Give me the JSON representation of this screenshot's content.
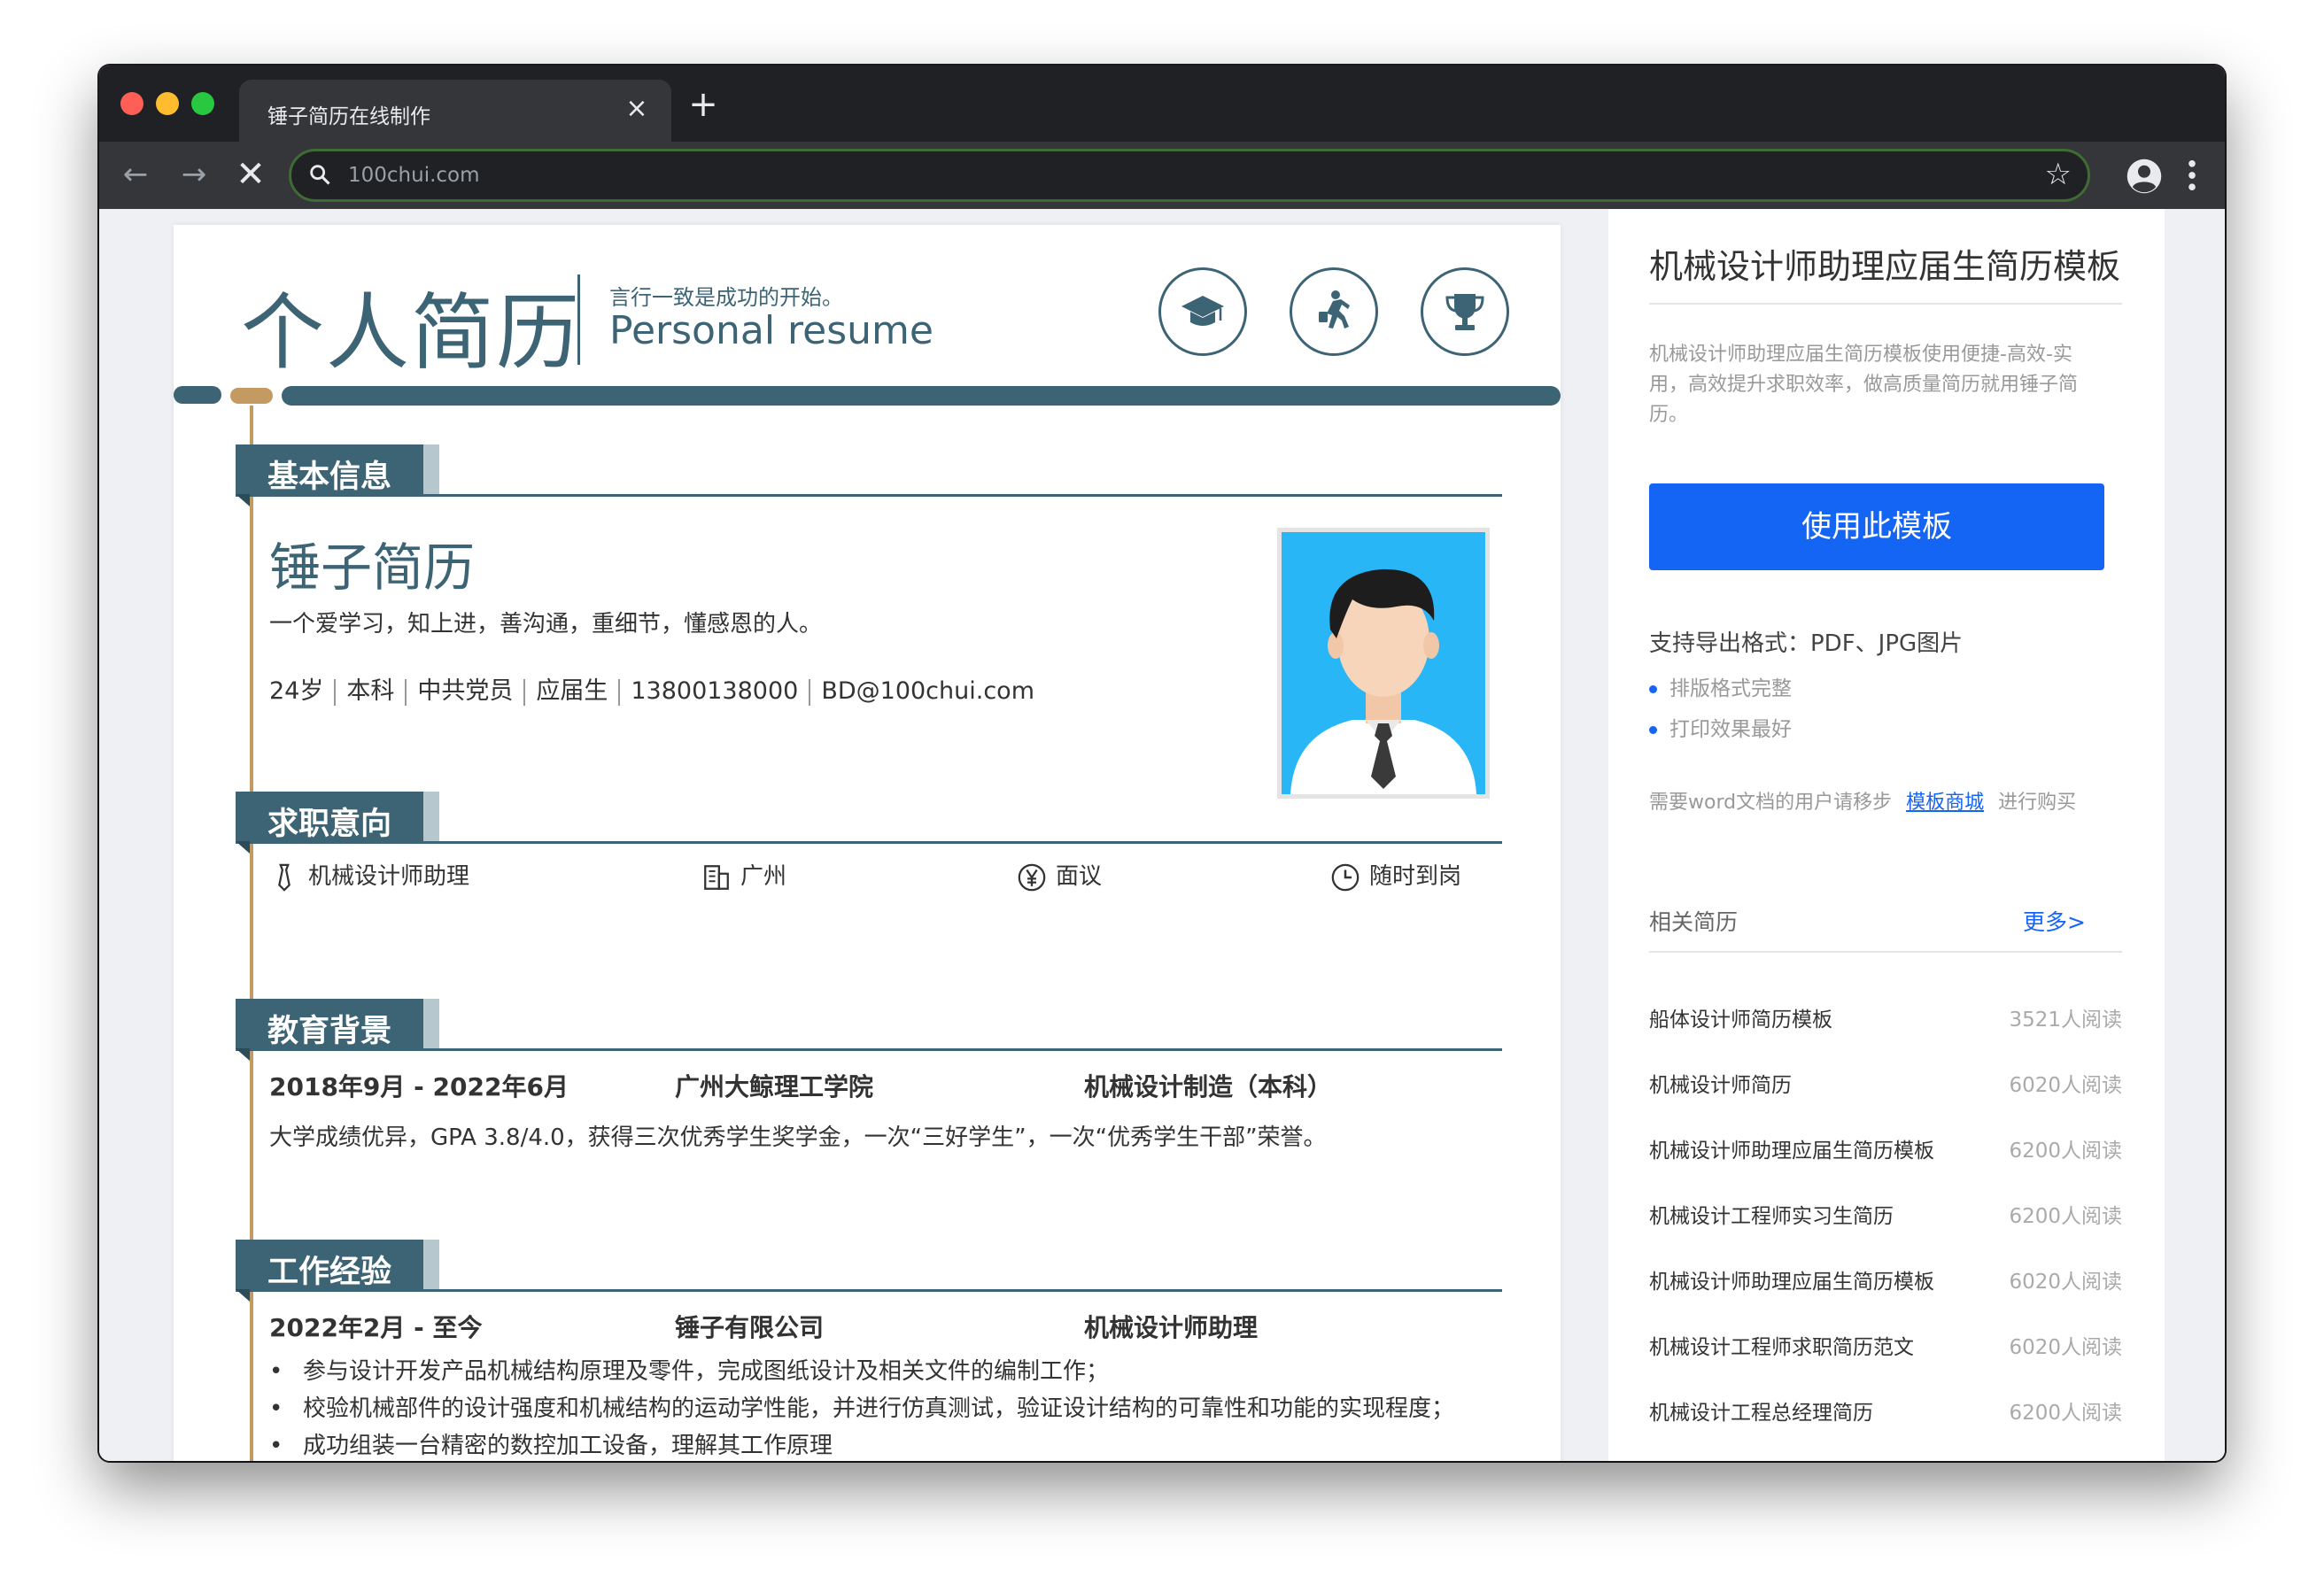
{
  "browser": {
    "tab_title": "锤子简历在线制作",
    "tab_close": "×",
    "new_tab": "+",
    "url": "100chui.com"
  },
  "resume": {
    "title": "个人简历",
    "subtitle_cn": "言行一致是成功的开始。",
    "subtitle_en": "Personal resume",
    "basic": {
      "heading": "基本信息",
      "name": "锤子简历",
      "motto": "一个爱学习，知上进，善沟通，重细节，懂感恩的人。",
      "details": [
        "24岁",
        "本科",
        "中共党员",
        "应届生",
        "13800138000",
        "BD@100chui.com"
      ]
    },
    "intention": {
      "heading": "求职意向",
      "position": "机械设计师助理",
      "city": "广州",
      "salary": "面议",
      "availability": "随时到岗"
    },
    "education": {
      "heading": "教育背景",
      "period": "2018年9月 - 2022年6月",
      "school": "广州大鲸理工学院",
      "major": "机械设计制造（本科）",
      "description": "大学成绩优异，GPA 3.8/4.0，获得三次优秀学生奖学金，一次“三好学生”，一次“优秀学生干部”荣誉。"
    },
    "work": {
      "heading": "工作经验",
      "period": "2022年2月 - 至今",
      "company": "锤子有限公司",
      "role": "机械设计师助理",
      "bullets": [
        "参与设计开发产品机械结构原理及零件，完成图纸设计及相关文件的编制工作；",
        "校验机械部件的设计强度和机械结构的运动学性能，并进行仿真测试，验证设计结构的可靠性和功能的实现程度；",
        "成功组装一台精密的数控加工设备，理解其工作原理"
      ]
    }
  },
  "sidebar": {
    "title": "机械设计师助理应届生简历模板",
    "description": "机械设计师助理应届生简历模板使用便捷-高效-实用，高效提升求职效率，做高质量简历就用锤子简历。",
    "use_button": "使用此模板",
    "formats": "支持导出格式：PDF、JPG图片",
    "features": [
      "排版格式完整",
      "打印效果最好"
    ],
    "note_before": "需要word文档的用户请移步",
    "note_link": "模板商城",
    "note_after": "进行购买",
    "related_title": "相关简历",
    "more": "更多>",
    "related": [
      {
        "name": "船体设计师简历模板",
        "reads": "3521人阅读"
      },
      {
        "name": "机械设计师简历",
        "reads": "6020人阅读"
      },
      {
        "name": "机械设计师助理应届生简历模板",
        "reads": "6200人阅读"
      },
      {
        "name": "机械设计工程师实习生简历",
        "reads": "6200人阅读"
      },
      {
        "name": "机械设计师助理应届生简历模板",
        "reads": "6020人阅读"
      },
      {
        "name": "机械设计工程师求职简历范文",
        "reads": "6020人阅读"
      },
      {
        "name": "机械设计工程总经理简历",
        "reads": "6200人阅读"
      }
    ]
  },
  "colors": {
    "resume_accent": "#3d6475",
    "timeline": "#c49a63",
    "button_blue": "#1565f5"
  },
  "icons": {
    "header": [
      "graduation-cap-icon",
      "running-person-icon",
      "trophy-icon"
    ],
    "intention": [
      "tie-icon",
      "building-icon",
      "yen-icon",
      "clock-icon"
    ]
  }
}
